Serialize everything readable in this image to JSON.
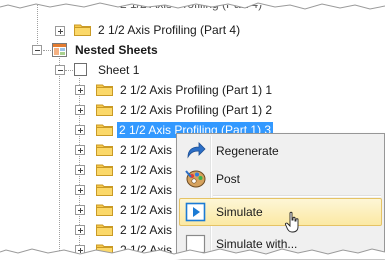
{
  "tree": {
    "top_item": "2 1/2 Axis Profiling (Part 4)",
    "cut_item": "2 1/2 Axis Profiling (Part 4)",
    "nested_sheets_label": "Nested Sheets",
    "sheet_label": "Sheet 1",
    "children": [
      "2 1/2 Axis Profiling (Part 1) 1",
      "2 1/2 Axis Profiling (Part 1) 2",
      "2 1/2 Axis Profiling (Part 1) 3",
      "2 1/2 Axis Pro",
      "2 1/2 Axis P",
      "2 1/2 Axis P",
      "2 1/2 Axis P",
      "2 1/2 Axis P",
      "2 1/2 Axis P"
    ],
    "selected_index": 2
  },
  "context_menu": {
    "items": [
      {
        "label": "Regenerate",
        "icon": "regenerate-arrow-icon"
      },
      {
        "label": "Post",
        "icon": "post-processor-icon"
      },
      {
        "label": "Simulate",
        "icon": "simulate-play-icon"
      },
      {
        "label": "Simulate with...",
        "icon": "simulate-with-icon"
      }
    ],
    "hovered_index": 2
  },
  "colors": {
    "selection": "#3399ff",
    "folder": "#f7c849",
    "menu_bg": "#f0f0f0",
    "hover_bg": "#fbe9a4",
    "regenerate_icon": "#2c6fc7",
    "simulate_icon": "#1c7bd4"
  }
}
